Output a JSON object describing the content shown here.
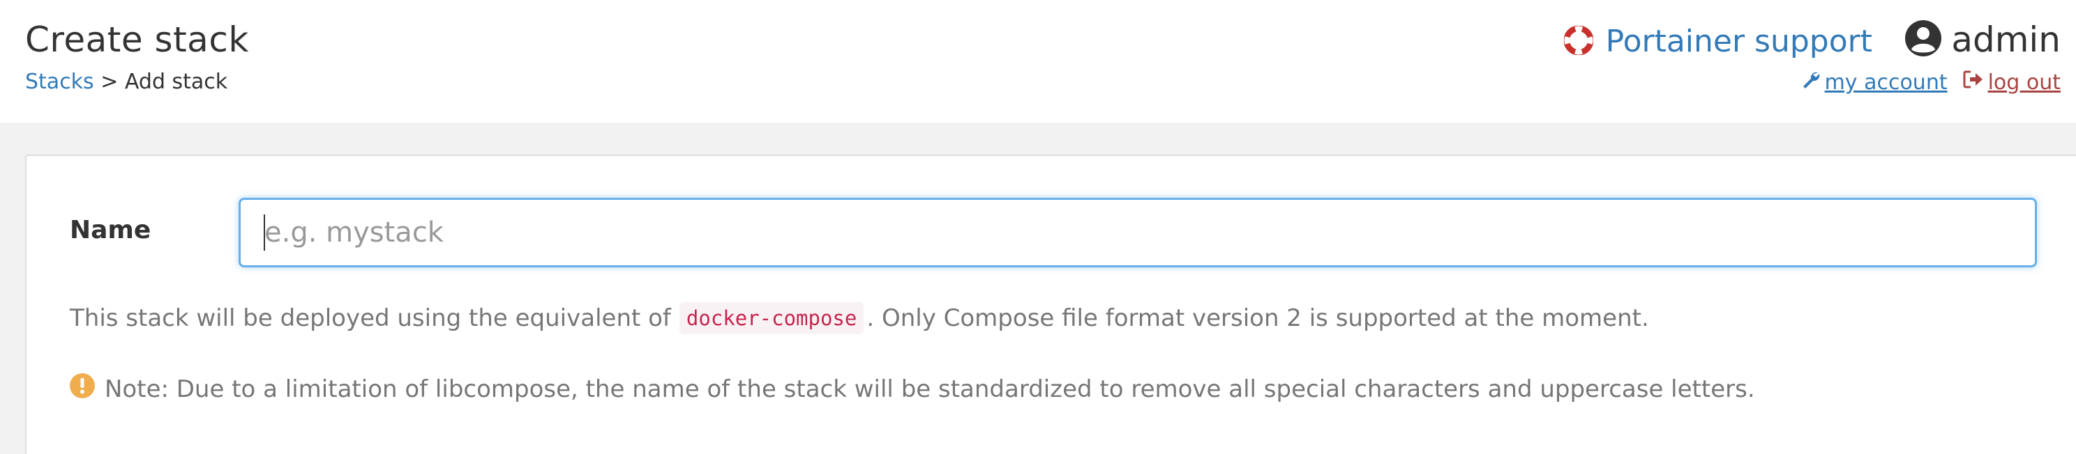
{
  "header": {
    "title": "Create stack",
    "breadcrumb": {
      "link": "Stacks",
      "separator": " > ",
      "current": "Add stack"
    },
    "support_label": "Portainer support",
    "username": "admin",
    "my_account_label": " my account ",
    "logout_label": " log out"
  },
  "form": {
    "name_label": "Name",
    "name_placeholder": "e.g. mystack",
    "name_value": ""
  },
  "info": {
    "desc_before": "This stack will be deployed using the equivalent of",
    "desc_code": "docker-compose",
    "desc_after": ". Only Compose file format version 2 is supported at the moment.",
    "note": "Note: Due to a limitation of libcompose, the name of the stack will be standardized to remove all special characters and uppercase letters."
  },
  "colors": {
    "link": "#337ab7",
    "danger": "#a94442",
    "warning": "#f0ad4e",
    "support_icon": "#c9302c",
    "code_text": "#c7254e",
    "input_focus": "#66afe9"
  },
  "icons": {
    "support": "life-ring-icon",
    "user": "user-circle-icon",
    "account": "wrench-icon",
    "logout": "sign-out-icon",
    "note": "exclamation-circle-icon"
  }
}
